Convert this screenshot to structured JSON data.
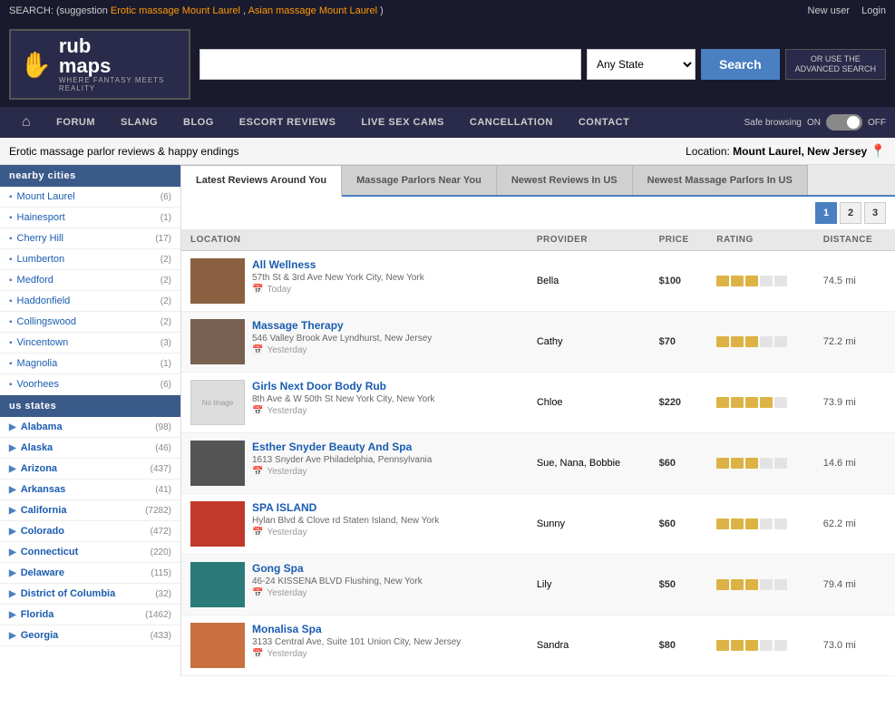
{
  "topbar": {
    "search_label": "SEARCH:",
    "suggestion_prefix": "(suggestion",
    "suggestion_link1": "Erotic massage Mount Laurel",
    "suggestion_comma": ",",
    "suggestion_link2": "Asian massage Mount Laurel",
    "suggestion_suffix": ")",
    "new_user": "New user",
    "login": "Login"
  },
  "search": {
    "placeholder": "",
    "state_default": "Any State",
    "search_btn": "Search",
    "advanced": "OR USE THE",
    "advanced2": "ADVANCED SEARCH"
  },
  "nav": {
    "home_icon": "⌂",
    "items": [
      {
        "label": "FORUM",
        "id": "forum"
      },
      {
        "label": "SLANG",
        "id": "slang"
      },
      {
        "label": "BLOG",
        "id": "blog"
      },
      {
        "label": "ESCORT REVIEWS",
        "id": "escort-reviews"
      },
      {
        "label": "LIVE SEX CAMS",
        "id": "live-sex-cams"
      },
      {
        "label": "CANCELLATION",
        "id": "cancellation"
      },
      {
        "label": "CONTACT",
        "id": "contact"
      }
    ],
    "safe_browsing": "Safe browsing",
    "on_label": "ON",
    "off_label": "OFF"
  },
  "breadcrumb": {
    "text": "Erotic massage parlor reviews & happy endings",
    "location_prefix": "Location:",
    "location_city": "Mount Laurel, New Jersey"
  },
  "sidebar": {
    "nearby_title": "nearby cities",
    "cities": [
      {
        "name": "Mount Laurel",
        "count": 6
      },
      {
        "name": "Hainesport",
        "count": 1
      },
      {
        "name": "Cherry Hill",
        "count": 17
      },
      {
        "name": "Lumberton",
        "count": 2
      },
      {
        "name": "Medford",
        "count": 2
      },
      {
        "name": "Haddonfield",
        "count": 2
      },
      {
        "name": "Collingswood",
        "count": 2
      },
      {
        "name": "Vincentown",
        "count": 3
      },
      {
        "name": "Magnolia",
        "count": 1
      },
      {
        "name": "Voorhees",
        "count": 6
      }
    ],
    "states_title": "us states",
    "states": [
      {
        "name": "Alabama",
        "count": 98
      },
      {
        "name": "Alaska",
        "count": 46
      },
      {
        "name": "Arizona",
        "count": 437
      },
      {
        "name": "Arkansas",
        "count": 41
      },
      {
        "name": "California",
        "count": 7282
      },
      {
        "name": "Colorado",
        "count": 472
      },
      {
        "name": "Connecticut",
        "count": 220
      },
      {
        "name": "Delaware",
        "count": 115
      },
      {
        "name": "District of Columbia",
        "count": 32
      },
      {
        "name": "Florida",
        "count": 1462
      },
      {
        "name": "Georgia",
        "count": 433
      }
    ]
  },
  "tabs": [
    {
      "label": "Latest Reviews Around You",
      "id": "latest-reviews",
      "active": true
    },
    {
      "label": "Massage Parlors Near You",
      "id": "massage-parlors",
      "active": false
    },
    {
      "label": "Newest Reviews In US",
      "id": "newest-reviews-us",
      "active": false
    },
    {
      "label": "Newest Massage Parlors In US",
      "id": "newest-parlors-us",
      "active": false
    }
  ],
  "pagination": [
    "1",
    "2",
    "3"
  ],
  "table": {
    "headers": {
      "location": "LOCATION",
      "provider": "PROVIDER",
      "price": "PRICE",
      "rating": "RATING",
      "distance": "DISTANCE"
    },
    "rows": [
      {
        "id": 1,
        "name": "All Wellness",
        "address": "57th St & 3rd Ave New York City, New York",
        "date": "Today",
        "provider": "Bella",
        "price": "$100",
        "rating": 3,
        "distance": "74.5 mi",
        "thumb_color": "brown"
      },
      {
        "id": 2,
        "name": "Massage Therapy",
        "address": "546 Valley Brook Ave Lyndhurst, New Jersey",
        "date": "Yesterday",
        "provider": "Cathy",
        "price": "$70",
        "rating": 3,
        "distance": "72.2 mi",
        "thumb_color": "brown2"
      },
      {
        "id": 3,
        "name": "Girls Next Door Body Rub",
        "address": "8th Ave & W 50th St New York City, New York",
        "date": "Yesterday",
        "provider": "Chloe",
        "price": "$220",
        "rating": 4,
        "distance": "73.9 mi",
        "thumb_color": "placeholder"
      },
      {
        "id": 4,
        "name": "Esther Snyder Beauty And Spa",
        "address": "1613 Snyder Ave Philadelphia, Pennsylvania",
        "date": "Yesterday",
        "provider": "Sue, Nana, Bobbie",
        "price": "$60",
        "rating": 3,
        "distance": "14.6 mi",
        "thumb_color": "dark"
      },
      {
        "id": 5,
        "name": "SPA ISLAND",
        "address": "Hylan Blvd & Clove rd Staten Island, New York",
        "date": "Yesterday",
        "provider": "Sunny",
        "price": "$60",
        "rating": 3,
        "distance": "62.2 mi",
        "thumb_color": "red"
      },
      {
        "id": 6,
        "name": "Gong Spa",
        "address": "46-24 KISSENA BLVD Flushing, New York",
        "date": "Yesterday",
        "provider": "Lily",
        "price": "$50",
        "rating": 3,
        "distance": "79.4 mi",
        "thumb_color": "teal"
      },
      {
        "id": 7,
        "name": "Monalisa Spa",
        "address": "3133 Central Ave, Suite 101 Union City, New Jersey",
        "date": "Yesterday",
        "provider": "Sandra",
        "price": "$80",
        "rating": 3,
        "distance": "73.0 mi",
        "thumb_color": "orange"
      }
    ]
  },
  "logo": {
    "rub": "rub",
    "maps": "maps",
    "tagline": "WHERE FANTASY MEETS REALITY"
  }
}
